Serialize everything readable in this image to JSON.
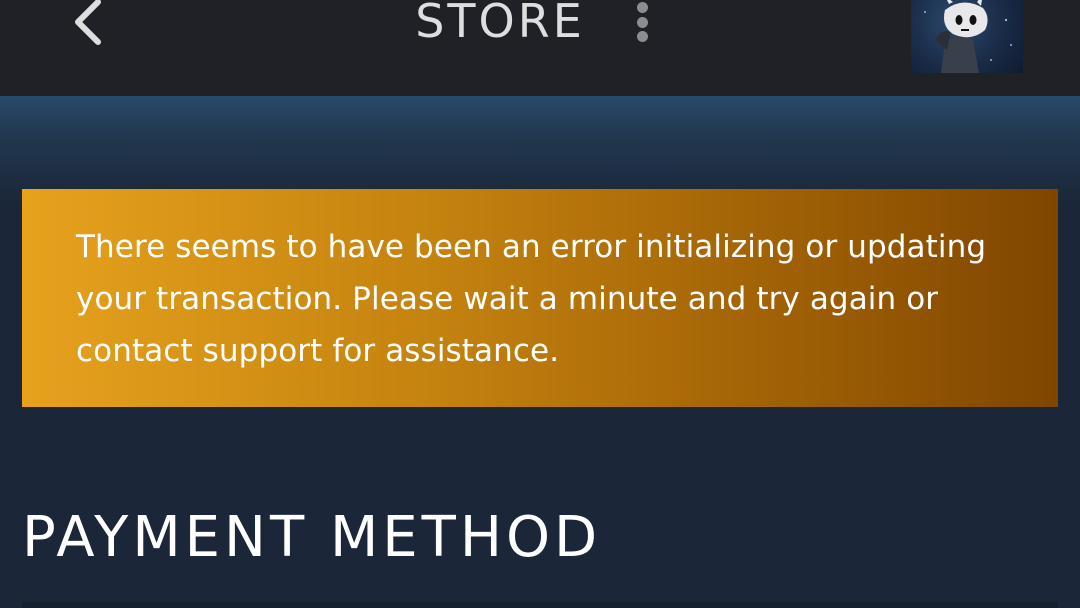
{
  "header": {
    "title": "STORE",
    "back_icon": "chevron-left-icon",
    "menu_icon": "kebab-menu-icon",
    "avatar_icon": "user-avatar"
  },
  "alert": {
    "message": "There seems to have been an error initializing or updating your transaction. Please wait a minute and try again or contact support for assistance.",
    "color_start": "#e6a21d",
    "color_end": "#7f4600"
  },
  "section": {
    "title": "PAYMENT METHOD"
  },
  "colors": {
    "topbar": "#1f2126",
    "page_background": "#1b2638",
    "header_gradient": "#2a4a6a",
    "text": "#ffffff"
  }
}
